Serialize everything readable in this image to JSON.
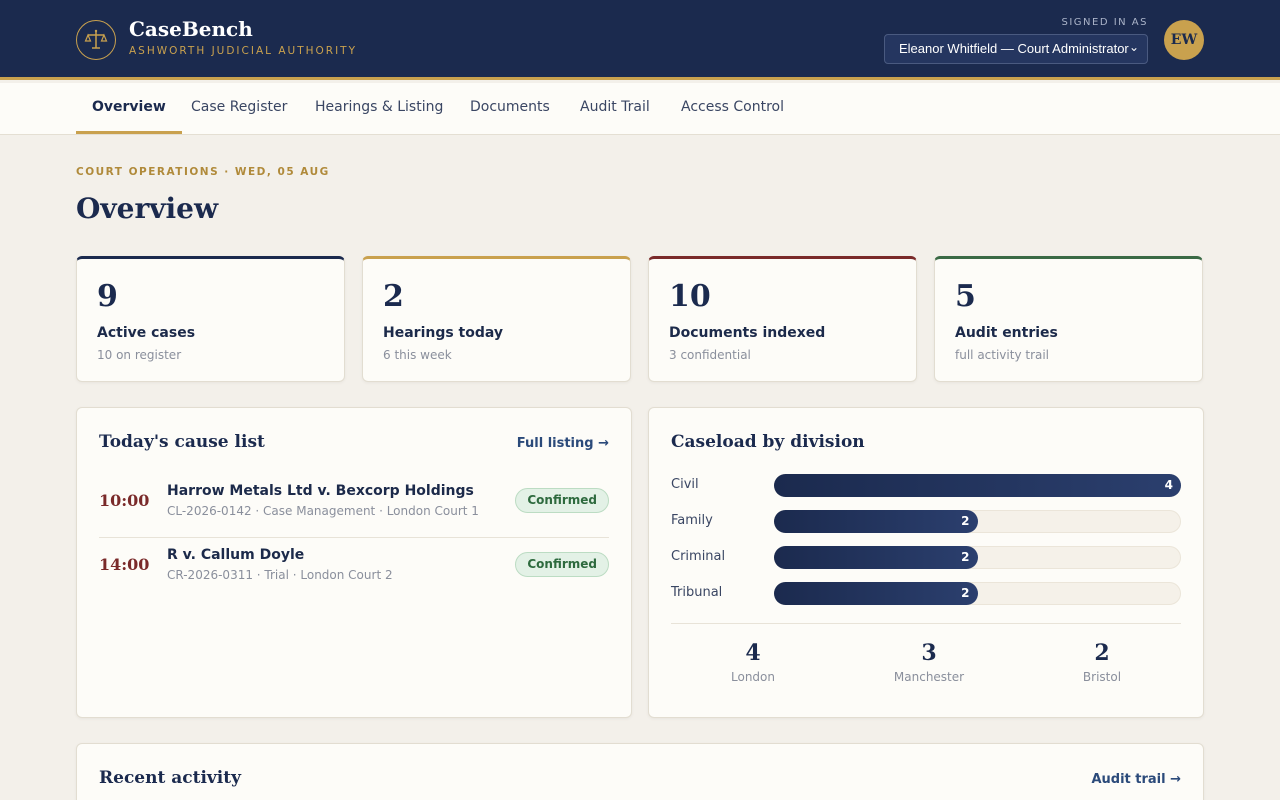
{
  "header": {
    "app_title": "CaseBench",
    "app_subtitle": "ASHWORTH JUDICIAL AUTHORITY",
    "signed_in_label": "SIGNED IN AS",
    "user_select_value": "Eleanor Whitfield — Court Administrator",
    "avatar_initials": "EW",
    "logo_icon": "scales-of-justice-icon",
    "accent_color": "#c9a14e",
    "bg_color": "#1b2a4e"
  },
  "nav": {
    "tabs": [
      {
        "label": "Overview",
        "active": true
      },
      {
        "label": "Case Register"
      },
      {
        "label": "Hearings & Listing"
      },
      {
        "label": "Documents"
      },
      {
        "label": "Audit Trail"
      },
      {
        "label": "Access Control"
      }
    ]
  },
  "page": {
    "eyebrow": "COURT OPERATIONS · WED, 05 AUG",
    "title": "Overview"
  },
  "stats": [
    {
      "value": "9",
      "label": "Active cases",
      "sub": "10 on register",
      "color": "#1b2a4e"
    },
    {
      "value": "2",
      "label": "Hearings today",
      "sub": "6 this week",
      "color": "#c9a14e"
    },
    {
      "value": "10",
      "label": "Documents indexed",
      "sub": "3 confidential",
      "color": "#7a2a2a"
    },
    {
      "value": "5",
      "label": "Audit entries",
      "sub": "full activity trail",
      "color": "#3a6a45"
    }
  ],
  "cause_list": {
    "title": "Today's cause list",
    "link": "Full listing →",
    "items": [
      {
        "time": "10:00",
        "case": "Harrow Metals Ltd v. Bexcorp Holdings",
        "meta": "CL-2026-0142 · Case Management · London Court 1",
        "status": "Confirmed"
      },
      {
        "time": "14:00",
        "case": "R v. Callum Doyle",
        "meta": "CR-2026-0311 · Trial · London Court 2",
        "status": "Confirmed"
      }
    ]
  },
  "caseload": {
    "title": "Caseload by division",
    "max": 4,
    "rows": [
      {
        "label": "Civil",
        "value": "4"
      },
      {
        "label": "Family",
        "value": "2"
      },
      {
        "label": "Criminal",
        "value": "2"
      },
      {
        "label": "Tribunal",
        "value": "2"
      }
    ],
    "locations": [
      {
        "value": "4",
        "name": "London"
      },
      {
        "value": "3",
        "name": "Manchester"
      },
      {
        "value": "2",
        "name": "Bristol"
      }
    ]
  },
  "activity": {
    "title": "Recent activity",
    "link": "Audit trail →"
  }
}
